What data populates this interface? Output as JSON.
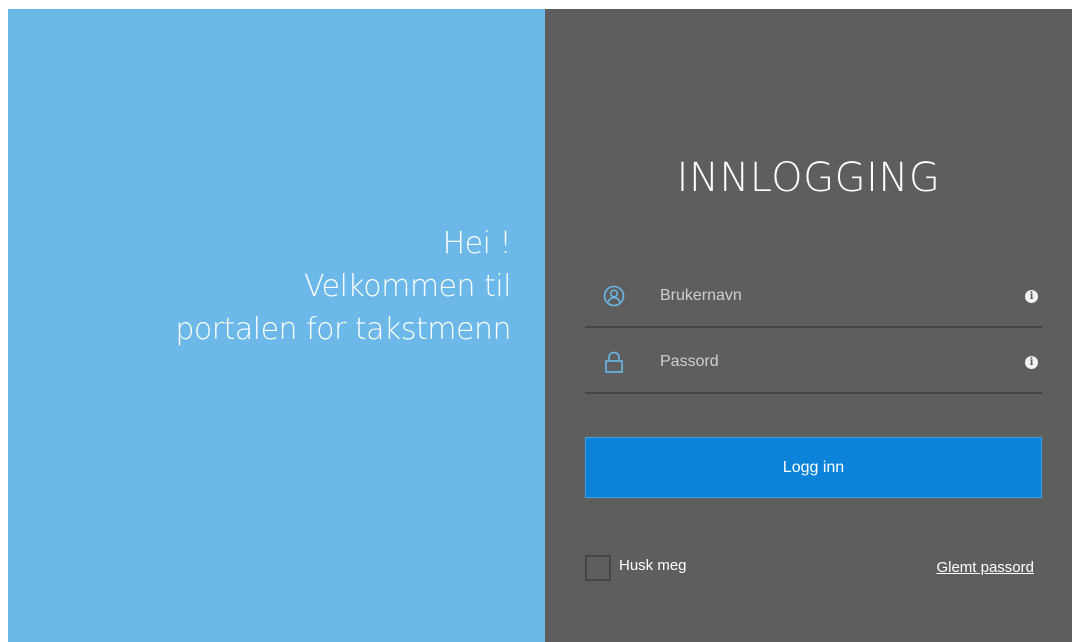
{
  "welcome": {
    "lines": [
      "Hei !",
      "Velkommen til",
      "portalen for takstmenn"
    ]
  },
  "login": {
    "title": "INNLOGGING",
    "username_placeholder": "Brukernavn",
    "password_placeholder": "Passord",
    "button_label": "Logg inn",
    "remember_label": "Husk meg",
    "forgot_label": "Glemt passord"
  },
  "colors": {
    "welcome_bg": "#6cb8e9",
    "login_bg": "#5e5e5e",
    "button_bg": "#0b83d9",
    "icon_accent": "#6cb8e9"
  },
  "icons": {
    "username": "user-icon",
    "password": "lock-icon",
    "info": "info-icon"
  }
}
